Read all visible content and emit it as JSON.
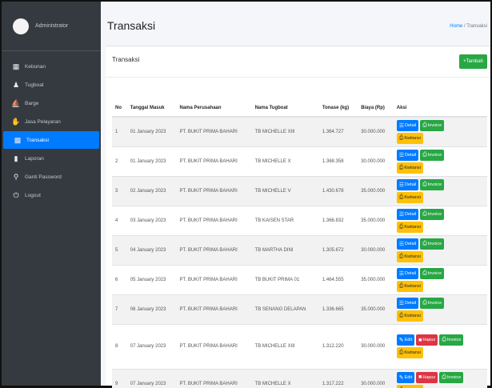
{
  "sidebar": {
    "brand": "Administrator",
    "items": [
      {
        "label": "Kebunan",
        "icon": "fence-icon"
      },
      {
        "label": "Tugboat",
        "icon": "user-tie-icon"
      },
      {
        "label": "Barge",
        "icon": "ship-icon"
      },
      {
        "label": "Jasa Pelayaran",
        "icon": "handshake-icon"
      },
      {
        "label": "Transaksi",
        "icon": "receipt-icon"
      },
      {
        "label": "Laporan",
        "icon": "book-icon"
      },
      {
        "label": "Ganti Password",
        "icon": "key-icon"
      },
      {
        "label": "Logout",
        "icon": "power-icon"
      }
    ]
  },
  "header": {
    "title": "Transaksi",
    "breadcrumb_home": "Home",
    "breadcrumb_current": "Transaksi"
  },
  "card": {
    "title": "Transaksi",
    "add_label": "Tambah"
  },
  "table": {
    "headers": [
      "No",
      "Tanggal Masuk",
      "Nama Perusahaan",
      "Nama Tugboat",
      "Tonase (kg)",
      "Biaya (Rp)",
      "Aksi"
    ],
    "rows": [
      {
        "no": "1",
        "tanggal": "01 January 2023",
        "perusahaan": "PT. BUKIT PRIMA BAHARI",
        "tugboat": "TB MICHELLE XIII",
        "tonase": "1.364.727",
        "biaya": "30.000.000"
      },
      {
        "no": "2",
        "tanggal": "01 January 2023",
        "perusahaan": "PT. BUKIT PRIMA BAHARI",
        "tugboat": "TB MICHELLE X",
        "tonase": "1.368.358",
        "biaya": "30.000.000"
      },
      {
        "no": "3",
        "tanggal": "02 January 2023",
        "perusahaan": "PT. BUKIT PRIMA BAHARI",
        "tugboat": "TB MICHELLE V",
        "tonase": "1.430.678",
        "biaya": "35.000.000"
      },
      {
        "no": "4",
        "tanggal": "03 January 2023",
        "perusahaan": "PT. BUKIT PRIMA BAHARI",
        "tugboat": "TB KAISEN STAR",
        "tonase": "1.366.832",
        "biaya": "35.000.000"
      },
      {
        "no": "5",
        "tanggal": "04 January 2023",
        "perusahaan": "PT. BUKIT PRIMA BAHARI",
        "tugboat": "TB MARTHA DINI",
        "tonase": "1.305.672",
        "biaya": "30.000.000"
      },
      {
        "no": "6",
        "tanggal": "05 January 2023",
        "perusahaan": "PT. BUKIT PRIMA BAHARI",
        "tugboat": "TB BUKIT PRIMA 01",
        "tonase": "1.464.555",
        "biaya": "35.000.000"
      },
      {
        "no": "7",
        "tanggal": "06 January 2023",
        "perusahaan": "PT. BUKIT PRIMA BAHARI",
        "tugboat": "TB SENANG DELAPAN",
        "tonase": "1.336.665",
        "biaya": "35.000.000"
      },
      {
        "no": "8",
        "tanggal": "07 January 2023",
        "perusahaan": "PT. BUKIT PRIMA BAHARI",
        "tugboat": "TB MICHELLE XIII",
        "tonase": "1.312.220",
        "biaya": "30.000.000"
      },
      {
        "no": "9",
        "tanggal": "07 January 2023",
        "perusahaan": "PT. BUKIT PRIMA BAHARI",
        "tugboat": "TB MICHELLE X",
        "tonase": "1.317.222",
        "biaya": "30.000.000"
      }
    ]
  },
  "actions": {
    "detail": "Detail",
    "invoice": "Invoice",
    "kwitansi": "Kwitansi",
    "edit": "Edit",
    "hapus": "Hapus"
  },
  "colors": {
    "sidebar": "#343a40",
    "active": "#007bff",
    "primary": "#007bff",
    "success": "#28a745",
    "warning": "#ffc107",
    "danger": "#dc3545"
  }
}
